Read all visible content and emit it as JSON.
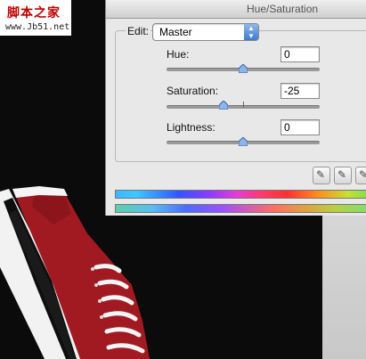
{
  "watermark": {
    "title": "脚本之家",
    "url": "www.Jb51.net"
  },
  "dialog": {
    "title": "Hue/Saturation",
    "edit_label": "Edit:",
    "edit_value": "Master",
    "hue": {
      "label": "Hue:",
      "value": "0"
    },
    "saturation": {
      "label": "Saturation:",
      "value": "-25"
    },
    "lightness": {
      "label": "Lightness:",
      "value": "0"
    }
  },
  "icons": [
    "eyedropper-icon",
    "eyedropper-plus-icon",
    "eyedropper-minus-icon"
  ],
  "colors": {
    "shoe_red": "#a11a22",
    "background": "#0b0b0b",
    "dialog_bg": "#e8e8e8"
  }
}
